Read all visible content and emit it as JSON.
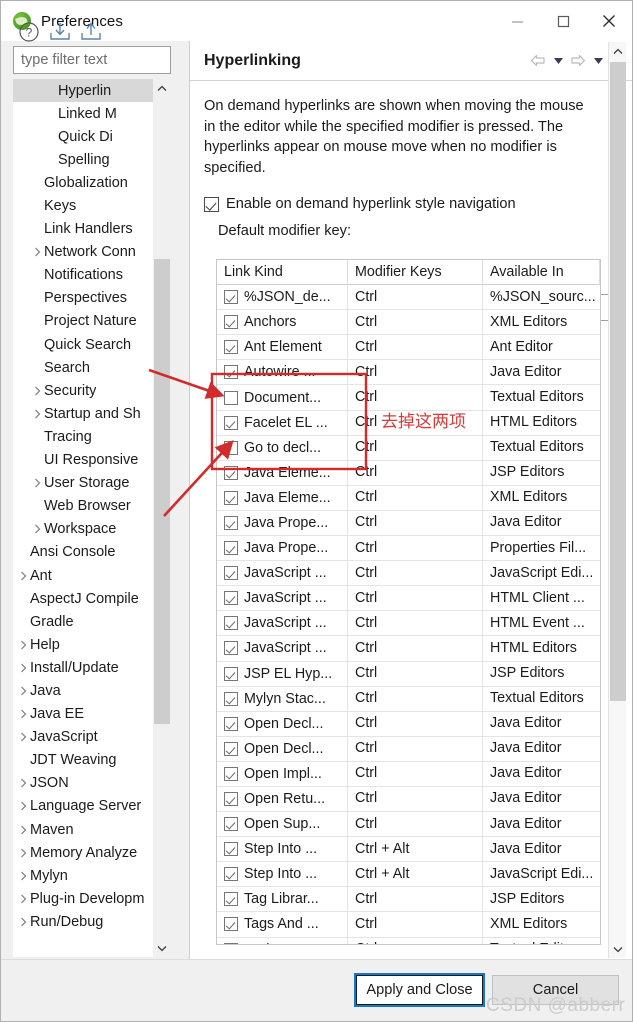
{
  "window": {
    "title": "Preferences",
    "icon": "eclipse-logo-icon",
    "minimize_label": "—",
    "maximize_label": "□",
    "close_label": "✕"
  },
  "sidebar": {
    "filter": {
      "value": "",
      "placeholder": "type filter text"
    },
    "items": [
      {
        "label": "Hyperlin",
        "indent": 3,
        "expander": "none",
        "selected": true
      },
      {
        "label": "Linked M",
        "indent": 3,
        "expander": "none",
        "selected": false
      },
      {
        "label": "Quick Di",
        "indent": 3,
        "expander": "none",
        "selected": false
      },
      {
        "label": "Spelling",
        "indent": 3,
        "expander": "none",
        "selected": false
      },
      {
        "label": "Globalization",
        "indent": 2,
        "expander": "none",
        "selected": false
      },
      {
        "label": "Keys",
        "indent": 2,
        "expander": "none",
        "selected": false
      },
      {
        "label": "Link Handlers",
        "indent": 2,
        "expander": "none",
        "selected": false
      },
      {
        "label": "Network Conn",
        "indent": 2,
        "expander": "collapsed",
        "selected": false
      },
      {
        "label": "Notifications",
        "indent": 2,
        "expander": "none",
        "selected": false
      },
      {
        "label": "Perspectives",
        "indent": 2,
        "expander": "none",
        "selected": false
      },
      {
        "label": "Project Nature",
        "indent": 2,
        "expander": "none",
        "selected": false
      },
      {
        "label": "Quick Search",
        "indent": 2,
        "expander": "none",
        "selected": false
      },
      {
        "label": "Search",
        "indent": 2,
        "expander": "none",
        "selected": false
      },
      {
        "label": "Security",
        "indent": 2,
        "expander": "collapsed",
        "selected": false
      },
      {
        "label": "Startup and Sh",
        "indent": 2,
        "expander": "collapsed",
        "selected": false
      },
      {
        "label": "Tracing",
        "indent": 2,
        "expander": "none",
        "selected": false
      },
      {
        "label": "UI Responsive",
        "indent": 2,
        "expander": "none",
        "selected": false
      },
      {
        "label": "User Storage",
        "indent": 2,
        "expander": "collapsed",
        "selected": false
      },
      {
        "label": "Web Browser",
        "indent": 2,
        "expander": "none",
        "selected": false
      },
      {
        "label": "Workspace",
        "indent": 2,
        "expander": "collapsed",
        "selected": false
      },
      {
        "label": "Ansi Console",
        "indent": 1,
        "expander": "none",
        "selected": false
      },
      {
        "label": "Ant",
        "indent": 1,
        "expander": "collapsed",
        "selected": false
      },
      {
        "label": "AspectJ Compile",
        "indent": 1,
        "expander": "none",
        "selected": false
      },
      {
        "label": "Gradle",
        "indent": 1,
        "expander": "none",
        "selected": false
      },
      {
        "label": "Help",
        "indent": 1,
        "expander": "collapsed",
        "selected": false
      },
      {
        "label": "Install/Update",
        "indent": 1,
        "expander": "collapsed",
        "selected": false
      },
      {
        "label": "Java",
        "indent": 1,
        "expander": "collapsed",
        "selected": false
      },
      {
        "label": "Java EE",
        "indent": 1,
        "expander": "collapsed",
        "selected": false
      },
      {
        "label": "JavaScript",
        "indent": 1,
        "expander": "collapsed",
        "selected": false
      },
      {
        "label": "JDT Weaving",
        "indent": 1,
        "expander": "none",
        "selected": false
      },
      {
        "label": "JSON",
        "indent": 1,
        "expander": "collapsed",
        "selected": false
      },
      {
        "label": "Language Server",
        "indent": 1,
        "expander": "collapsed",
        "selected": false
      },
      {
        "label": "Maven",
        "indent": 1,
        "expander": "collapsed",
        "selected": false
      },
      {
        "label": "Memory Analyze",
        "indent": 1,
        "expander": "collapsed",
        "selected": false
      },
      {
        "label": "Mylyn",
        "indent": 1,
        "expander": "collapsed",
        "selected": false
      },
      {
        "label": "Plug-in Developm",
        "indent": 1,
        "expander": "collapsed",
        "selected": false
      },
      {
        "label": "Run/Debug",
        "indent": 1,
        "expander": "collapsed",
        "selected": false
      }
    ]
  },
  "panel": {
    "title": "Hyperlinking",
    "description": "On demand hyperlinks are shown when moving the mouse in the editor while the specified modifier is pressed. The hyperlinks appear on mouse move when no modifier is specified.",
    "enable_checkbox": {
      "label": "Enable on demand hyperlink style navigation",
      "checked": true
    },
    "modifier_label": "Default modifier key:",
    "modifier_value": "Ctrl",
    "nav": {
      "back": "back-arrow-icon",
      "back_menu": "back-dropdown-icon",
      "forward": "forward-arrow-icon",
      "forward_menu": "forward-dropdown-icon",
      "view_menu": "view-menu-icon"
    }
  },
  "table": {
    "columns": [
      "Link Kind",
      "Modifier Keys",
      "Available In"
    ],
    "rows": [
      {
        "checked": true,
        "kind": "%JSON_de...",
        "modifier": "Ctrl",
        "available": "%JSON_sourc..."
      },
      {
        "checked": true,
        "kind": "Anchors",
        "modifier": "Ctrl",
        "available": "XML Editors"
      },
      {
        "checked": true,
        "kind": "Ant Element",
        "modifier": "Ctrl",
        "available": "Ant Editor"
      },
      {
        "checked": true,
        "kind": "Autowire ...",
        "modifier": "Ctrl",
        "available": "Java Editor"
      },
      {
        "checked": false,
        "kind": "Document...",
        "modifier": "Ctrl",
        "available": "Textual Editors"
      },
      {
        "checked": true,
        "kind": "Facelet EL ...",
        "modifier": "Ctrl",
        "available": "HTML Editors"
      },
      {
        "checked": false,
        "kind": "Go to decl...",
        "modifier": "Ctrl",
        "available": "Textual Editors"
      },
      {
        "checked": true,
        "kind": "Java Eleme...",
        "modifier": "Ctrl",
        "available": "JSP Editors"
      },
      {
        "checked": true,
        "kind": "Java Eleme...",
        "modifier": "Ctrl",
        "available": "XML Editors"
      },
      {
        "checked": true,
        "kind": "Java Prope...",
        "modifier": "Ctrl",
        "available": "Java Editor"
      },
      {
        "checked": true,
        "kind": "Java Prope...",
        "modifier": "Ctrl",
        "available": "Properties Fil..."
      },
      {
        "checked": true,
        "kind": "JavaScript ...",
        "modifier": "Ctrl",
        "available": "JavaScript Edi..."
      },
      {
        "checked": true,
        "kind": "JavaScript ...",
        "modifier": "Ctrl",
        "available": "HTML Client ..."
      },
      {
        "checked": true,
        "kind": "JavaScript ...",
        "modifier": "Ctrl",
        "available": "HTML Event ..."
      },
      {
        "checked": true,
        "kind": "JavaScript ...",
        "modifier": "Ctrl",
        "available": "HTML Editors"
      },
      {
        "checked": true,
        "kind": "JSP EL Hyp...",
        "modifier": "Ctrl",
        "available": "JSP Editors"
      },
      {
        "checked": true,
        "kind": "Mylyn Stac...",
        "modifier": "Ctrl",
        "available": "Textual Editors"
      },
      {
        "checked": true,
        "kind": "Open Decl...",
        "modifier": "Ctrl",
        "available": "Java Editor"
      },
      {
        "checked": true,
        "kind": "Open Decl...",
        "modifier": "Ctrl",
        "available": "Java Editor"
      },
      {
        "checked": true,
        "kind": "Open Impl...",
        "modifier": "Ctrl",
        "available": "Java Editor"
      },
      {
        "checked": true,
        "kind": "Open Retu...",
        "modifier": "Ctrl",
        "available": "Java Editor"
      },
      {
        "checked": true,
        "kind": "Open Sup...",
        "modifier": "Ctrl",
        "available": "Java Editor"
      },
      {
        "checked": true,
        "kind": "Step Into ...",
        "modifier": "Ctrl + Alt",
        "available": "Java Editor"
      },
      {
        "checked": true,
        "kind": "Step Into ...",
        "modifier": "Ctrl + Alt",
        "available": "JavaScript Edi..."
      },
      {
        "checked": true,
        "kind": "Tag Librar...",
        "modifier": "Ctrl",
        "available": "JSP Editors"
      },
      {
        "checked": true,
        "kind": "Tags And ...",
        "modifier": "Ctrl",
        "available": "XML Editors"
      },
      {
        "checked": true,
        "kind": "Task URLs",
        "modifier": "Ctrl",
        "available": "Textual Editors"
      }
    ]
  },
  "footer": {
    "help_icon": "help-icon",
    "import_icon": "import-icon",
    "export_icon": "export-icon",
    "apply_label": "Apply and Close",
    "cancel_label": "Cancel",
    "watermark": "CSDN @abberr"
  },
  "annotation": {
    "text": "去掉这两项",
    "color": "#d23b3b"
  }
}
